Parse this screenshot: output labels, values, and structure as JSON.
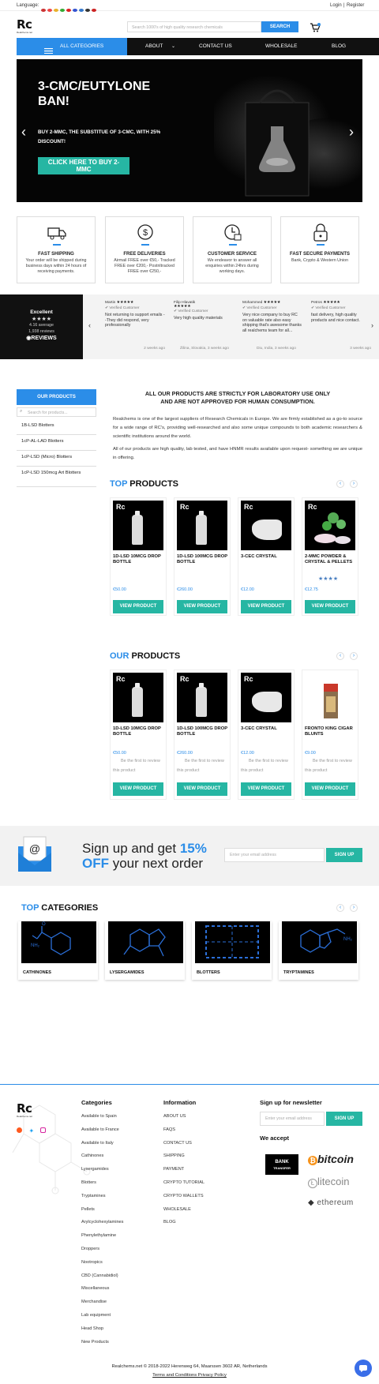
{
  "topbar": {
    "language_label": "Language:",
    "login": "Login",
    "sep": "|",
    "register": "Register"
  },
  "header": {
    "logo": "Rc",
    "logo_sub": "Realchems.net",
    "search_placeholder": "Search 1000's of high quality research chemicals",
    "search_button": "SEARCH"
  },
  "nav": {
    "all_categories": "ALL CATEGORIES",
    "items": [
      "ABOUT",
      "CONTACT US",
      "WHOLESALE",
      "BLOG"
    ]
  },
  "hero": {
    "title_line1": "3-CMC/EUTYLONE",
    "title_line2": "BAN!",
    "subtitle_line1": "BUY 2-MMC, THE SUBSTITUE OF 3-CMC, WITH 25%",
    "subtitle_line2": "DISCOUNT!",
    "cta_line1": "CLICK HERE TO BUY 2-",
    "cta_line2": "MMC"
  },
  "features": [
    {
      "title": "FAST SHIPPING",
      "desc": "Your order will be shipped during business days within 24 hours of receiving payments.",
      "icon": "truck-icon"
    },
    {
      "title": "FREE DELIVERIES",
      "desc": "Airmail FREE over €50,- Tracked FREE over €200,- Postnltracked FREE over €250,-",
      "icon": "dollar-icon"
    },
    {
      "title": "CUSTOMER SERVICE",
      "desc": "We endeavor to answer all enquiries within 24hrs during working days.",
      "icon": "support-icon"
    },
    {
      "title": "FAST SECURE PAYMENTS",
      "desc": "Bank, Crypto & Western Union",
      "icon": "lock-icon"
    }
  ],
  "reviews_widget": {
    "rating_label": "Excellent",
    "stars": "★★★★",
    "average": "4.16 average",
    "count": "1,938 reviews",
    "brand": "REVIEWS",
    "items": [
      {
        "name": "Martin",
        "stars": "★★★★★",
        "verified": "Verified Customer",
        "text": "Not returning to support emails --They did respond, very professionally",
        "date": "2 weeks ago"
      },
      {
        "name": "Filip Hlavatik",
        "stars": "★★★★★",
        "verified": "Verified Customer",
        "text": "Very high quality materials",
        "date": "Žilina, Slovakia, 3 weeks ago"
      },
      {
        "name": "Mohammed",
        "stars": "★★★★★",
        "verified": "Verified Customer",
        "text": "Very nice company to buy RC on valuable rate also easy shipping that's awesome thanks all realchems team for all...",
        "date": "Diu, India, 3 weeks ago"
      },
      {
        "name": "Petros",
        "stars": "★★★★★",
        "verified": "Verified Customer",
        "text": "fast delivery, high quality products and nice contact.",
        "date": "3 weeks ago"
      }
    ]
  },
  "sidebar": {
    "title": "OUR PRODUCTS",
    "search_placeholder": "Search for products...",
    "items": [
      "1B-LSD Blotters",
      "1cP-AL-LAD Blotters",
      "1cP-LSD (Micro) Blotters",
      "1cP-LSD 150mcg Art Blotters"
    ]
  },
  "intro": {
    "warning_line1": "ALL OUR PRODUCTS ARE STRICTLY FOR LABORATORY USE ONLY",
    "warning_line2": "AND ARE NOT APPROVED FOR HUMAN CONSUMPTION.",
    "para1": "Realchems is one of the largest suppliers of Research Chemicals in Europe. We are firmly established as a go-to source for a wide range of RC's, providing well-researched and also some unique compounds to both academic researchers & scientific institutions around the world.",
    "para2": "All of our products are high quality, lab tested, and have HNMR results available upon request- something we are unique in offering."
  },
  "top_products": {
    "title_accent": "TOP",
    "title_rest": " PRODUCTS",
    "items": [
      {
        "name": "1D-LSD 10MCG DROP BOTTLE",
        "price": "€50.00",
        "button": "VIEW PRODUCT"
      },
      {
        "name": "1D-LSD 100MCG DROP BOTTLE",
        "price": "€260.00",
        "button": "VIEW PRODUCT"
      },
      {
        "name": "3-CEC CRYSTAL",
        "price": "€12.00",
        "button": "VIEW PRODUCT"
      },
      {
        "name": "2-MMC POWDER & CRYSTAL & PELLETS",
        "price": "€12.75",
        "stars": "★★★★",
        "rating": 4,
        "button": "VIEW PRODUCT"
      }
    ]
  },
  "our_products": {
    "title_accent": "OUR",
    "title_rest": " PRODUCTS",
    "items": [
      {
        "name": "1D-LSD 10MCG DROP BOTTLE",
        "price": "€50.00",
        "review": "Be the first to review this product",
        "button": "VIEW PRODUCT"
      },
      {
        "name": "1D-LSD 100MCG DROP BOTTLE",
        "price": "€260.00",
        "review": "Be the first to review this product",
        "button": "VIEW PRODUCT"
      },
      {
        "name": "3-CEC CRYSTAL",
        "price": "€12.00",
        "review": "Be the first to review this product",
        "button": "VIEW PRODUCT"
      },
      {
        "name": "FRONTO KING CIGAR BLUNTS",
        "price": "€9.00",
        "review": "Be the first to review this product",
        "button": "VIEW PRODUCT"
      }
    ]
  },
  "signup": {
    "line1_a": "Sign up and get ",
    "line1_b": "15%",
    "line2_a": "OFF",
    "line2_b": " your next order",
    "placeholder": "Enter your email address",
    "button": "SIGN UP"
  },
  "categories": {
    "title_accent": "TOP",
    "title_rest": " CATEGORIES",
    "items": [
      "CATHINONES",
      "LYSERGAMIDES",
      "BLOTTERS",
      "TRYPTAMINES"
    ]
  },
  "footer": {
    "logo": "Rc",
    "logo_sub": "Realchems.net",
    "categories_title": "Categories",
    "categories": [
      "Available to Spain",
      "Available to France",
      "Available to Italy",
      "Cathinones",
      "Lysergamides",
      "Blotters",
      "Tryptamines",
      "Pellets",
      "Arylcyclohexylamines",
      "Phenylethylamine",
      "Droppers",
      "Nootropics",
      "CBD (Cannabidiol)",
      "Miscellaneous",
      "Merchandise",
      "Lab equipment",
      "Head Shop",
      "New Products"
    ],
    "info_title": "Information",
    "info": [
      "ABOUT US",
      "FAQS",
      "CONTACT US",
      "SHIPPING",
      "PAYMENT",
      "CRYPTO TUTORIAL",
      "CRYPTO WALLETS",
      "WHOLESALE",
      "BLOG"
    ],
    "newsletter_title": "Sign up for newsletter",
    "newsletter_placeholder": "Enter your email address",
    "newsletter_button": "SIGN UP",
    "accept_title": "We accept",
    "payments": {
      "bank_line1": "BANK",
      "bank_line2": "TRANSFER",
      "bitcoin": "bitcoin",
      "litecoin": "litecoin",
      "ethereum": "ethereum"
    },
    "address": "Realchems.net © 2018-2022 Herenweg 64, Maarssen 3602 AR, Netherlands",
    "terms": "Terms and Conditions Privacy Policy"
  },
  "colors": {
    "accent": "#2b8de8",
    "button": "#26b6a3",
    "dark": "#111111"
  }
}
